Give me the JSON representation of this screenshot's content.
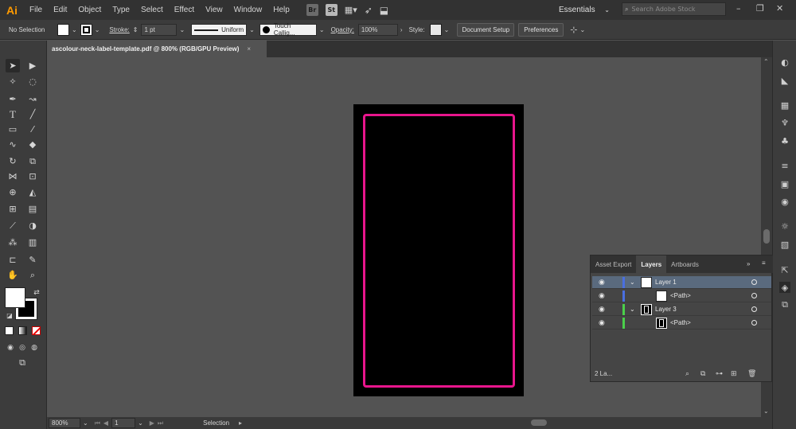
{
  "app": {
    "logo": "Ai",
    "menu": [
      "File",
      "Edit",
      "Object",
      "Type",
      "Select",
      "Effect",
      "View",
      "Window",
      "Help"
    ],
    "bridge_icon": "Br",
    "stock_icon": "St",
    "workspace": "Essentials",
    "search_placeholder": "Search Adobe Stock"
  },
  "control_bar": {
    "selection_state": "No Selection",
    "stroke_label": "Stroke:",
    "stroke_weight": "1 pt",
    "stroke_profile": "Uniform",
    "brush": "Touch Callig...",
    "opacity_label": "Opacity:",
    "opacity_value": "100%",
    "style_label": "Style:",
    "document_setup": "Document Setup",
    "preferences": "Preferences"
  },
  "document": {
    "tab_title": "ascolour-neck-label-template.pdf @ 800% (RGB/GPU Preview)",
    "close": "×"
  },
  "status_bar": {
    "zoom": "800%",
    "artboard": "1",
    "status": "Selection"
  },
  "layers_panel": {
    "tabs": [
      "Asset Export",
      "Layers",
      "Artboards"
    ],
    "active_tab": "Layers",
    "rows": [
      {
        "name": "Layer 1",
        "type": "layer",
        "color": "#4a6fe0",
        "selected": true
      },
      {
        "name": "<Path>",
        "type": "path",
        "color": "#4a6fe0",
        "selected": false
      },
      {
        "name": "Layer 3",
        "type": "layer",
        "color": "#4bd04b",
        "selected": false
      },
      {
        "name": "<Path>",
        "type": "path",
        "color": "#4bd04b",
        "selected": false
      }
    ],
    "footer_count": "2 La..."
  },
  "colors": {
    "artboard_fill": "#000000",
    "label_stroke": "#e8158c"
  }
}
